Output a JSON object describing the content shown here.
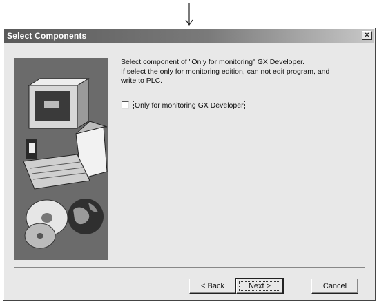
{
  "dialog": {
    "title": "Select Components",
    "close_label": "×"
  },
  "instructions": {
    "line1": "Select component of \"Only for monitoring\" GX Developer.",
    "line2": "If select the only for monitoring edition, can not edit program, and",
    "line3": "write to PLC."
  },
  "checkbox": {
    "label": "Only for monitoring GX Developer",
    "checked": false
  },
  "buttons": {
    "back": "< Back",
    "next": "Next >",
    "cancel": "Cancel"
  },
  "icons": {
    "arrow": "down-arrow-icon",
    "side_image": "computer-and-discs-illustration"
  }
}
